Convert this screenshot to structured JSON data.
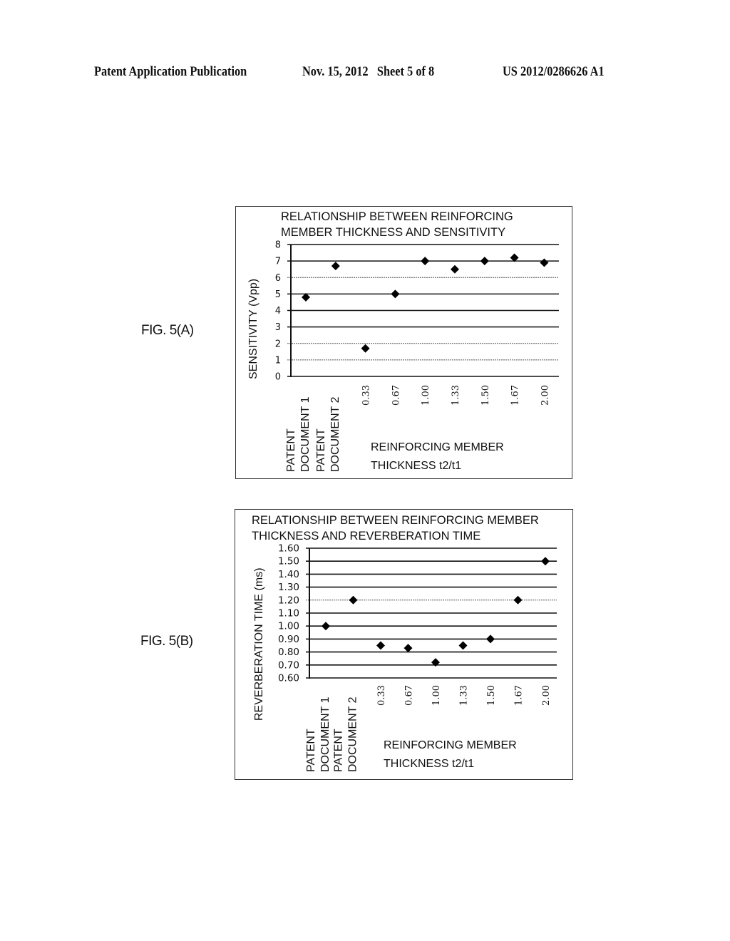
{
  "header": {
    "left": "Patent Application Publication",
    "date_sheet": "Nov. 15, 2012   Sheet 5 of 8",
    "number": "US 2012/0286626 A1"
  },
  "figures": [
    {
      "label": "FIG. 5(A)"
    },
    {
      "label": "FIG. 5(B)"
    }
  ],
  "chart_data": [
    {
      "type": "scatter",
      "title": "RELATIONSHIP BETWEEN REINFORCING\nMEMBER THICKNESS AND SENSITIVITY",
      "title_lines": [
        "RELATIONSHIP BETWEEN REINFORCING",
        "MEMBER THICKNESS AND SENSITIVITY"
      ],
      "ylabel": "SENSITIVITY (Vpp)",
      "xlabel_lines": [
        "REINFORCING MEMBER",
        "THICKNESS t2/t1"
      ],
      "categories": [
        [
          "PATENT",
          "DOCUMENT 1"
        ],
        [
          "PATENT",
          "DOCUMENT 2"
        ],
        [
          "0.33"
        ],
        [
          "0.67"
        ],
        [
          "1.00"
        ],
        [
          "1.33"
        ],
        [
          "1.50"
        ],
        [
          "1.67"
        ],
        [
          "2.00"
        ]
      ],
      "values": [
        4.8,
        6.7,
        1.7,
        5.0,
        7.0,
        6.5,
        7.0,
        7.2,
        6.9
      ],
      "ylim": [
        0,
        8
      ],
      "yticks": [
        "0",
        "1",
        "2",
        "3",
        "4",
        "5",
        "6",
        "7",
        "8"
      ],
      "grid": true,
      "marker": "diamond"
    },
    {
      "type": "scatter",
      "title": "RELATIONSHIP BETWEEN REINFORCING MEMBER\nTHICKNESS AND REVERBERATION TIME",
      "title_lines": [
        "RELATIONSHIP BETWEEN REINFORCING MEMBER",
        "THICKNESS AND REVERBERATION TIME"
      ],
      "ylabel": "REVERBERATION TIME (ms)",
      "xlabel_lines": [
        "REINFORCING MEMBER",
        "THICKNESS t2/t1"
      ],
      "categories": [
        [
          "PATENT",
          "DOCUMENT 1"
        ],
        [
          "PATENT",
          "DOCUMENT 2"
        ],
        [
          "0.33"
        ],
        [
          "0.67"
        ],
        [
          "1.00"
        ],
        [
          "1.33"
        ],
        [
          "1.50"
        ],
        [
          "1.67"
        ],
        [
          "2.00"
        ]
      ],
      "values": [
        1.0,
        1.2,
        0.85,
        0.83,
        0.72,
        0.85,
        0.9,
        1.2,
        1.5
      ],
      "ylim": [
        0.6,
        1.6
      ],
      "yticks": [
        "0.60",
        "0.70",
        "0.80",
        "0.90",
        "1.00",
        "1.10",
        "1.20",
        "1.30",
        "1.40",
        "1.50",
        "1.60"
      ],
      "grid": true,
      "marker": "diamond"
    }
  ]
}
